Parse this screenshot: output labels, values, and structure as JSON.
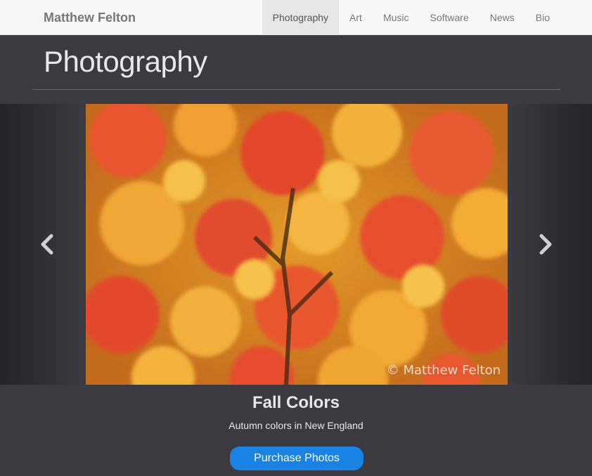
{
  "navbar": {
    "brand": "Matthew Felton",
    "items": [
      {
        "label": "Photography",
        "active": true
      },
      {
        "label": "Art",
        "active": false
      },
      {
        "label": "Music",
        "active": false
      },
      {
        "label": "Software",
        "active": false
      },
      {
        "label": "News",
        "active": false
      },
      {
        "label": "Bio",
        "active": false
      }
    ]
  },
  "page": {
    "title": "Photography"
  },
  "carousel": {
    "watermark": "© Matthew Felton",
    "prev_icon": "chevron-left-icon",
    "next_icon": "chevron-right-icon"
  },
  "slide": {
    "title": "Fall Colors",
    "description": "Autumn colors in New England",
    "button_label": "Purchase Photos"
  },
  "colors": {
    "background": "#3a3a40",
    "navbar_bg": "#f8f8f8",
    "button_bg": "#1a82e2"
  }
}
